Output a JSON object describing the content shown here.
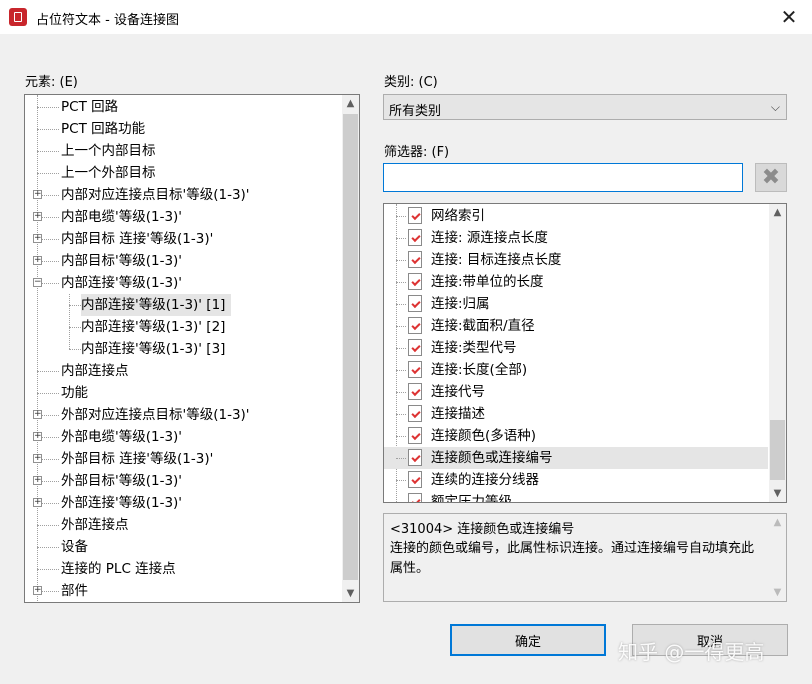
{
  "window": {
    "title": "占位符文本 - 设备连接图",
    "close_glyph": "✕"
  },
  "elements": {
    "label": "元素: (E)",
    "tree": [
      {
        "label": "PCT 回路",
        "level": 0,
        "expander": ""
      },
      {
        "label": "PCT 回路功能",
        "level": 0,
        "expander": ""
      },
      {
        "label": "上一个内部目标",
        "level": 0,
        "expander": ""
      },
      {
        "label": "上一个外部目标",
        "level": 0,
        "expander": ""
      },
      {
        "label": "内部对应连接点目标'等级(1-3)'",
        "level": 0,
        "expander": "+"
      },
      {
        "label": "内部电缆'等级(1-3)'",
        "level": 0,
        "expander": "+"
      },
      {
        "label": "内部目标 连接'等级(1-3)'",
        "level": 0,
        "expander": "+"
      },
      {
        "label": "内部目标'等级(1-3)'",
        "level": 0,
        "expander": "+"
      },
      {
        "label": "内部连接'等级(1-3)'",
        "level": 0,
        "expander": "−"
      },
      {
        "label": "内部连接'等级(1-3)' [1]",
        "level": 1,
        "expander": "",
        "selected": true
      },
      {
        "label": "内部连接'等级(1-3)' [2]",
        "level": 1,
        "expander": ""
      },
      {
        "label": "内部连接'等级(1-3)' [3]",
        "level": 1,
        "expander": ""
      },
      {
        "label": "内部连接点",
        "level": 0,
        "expander": ""
      },
      {
        "label": "功能",
        "level": 0,
        "expander": ""
      },
      {
        "label": "外部对应连接点目标'等级(1-3)'",
        "level": 0,
        "expander": "+"
      },
      {
        "label": "外部电缆'等级(1-3)'",
        "level": 0,
        "expander": "+"
      },
      {
        "label": "外部目标 连接'等级(1-3)'",
        "level": 0,
        "expander": "+"
      },
      {
        "label": "外部目标'等级(1-3)'",
        "level": 0,
        "expander": "+"
      },
      {
        "label": "外部连接'等级(1-3)'",
        "level": 0,
        "expander": "+"
      },
      {
        "label": "外部连接点",
        "level": 0,
        "expander": ""
      },
      {
        "label": "设备",
        "level": 0,
        "expander": ""
      },
      {
        "label": "连接的 PLC 连接点",
        "level": 0,
        "expander": ""
      },
      {
        "label": "部件",
        "level": 0,
        "expander": "+"
      }
    ]
  },
  "category": {
    "label": "类别: (C)",
    "value": "所有类别",
    "chevron": "⌵"
  },
  "filter": {
    "label": "筛选器: (F)",
    "value": "",
    "placeholder": "",
    "clear_glyph": "✖"
  },
  "properties": [
    {
      "label": "网络索引"
    },
    {
      "label": "连接: 源连接点长度"
    },
    {
      "label": "连接: 目标连接点长度"
    },
    {
      "label": "连接:带单位的长度"
    },
    {
      "label": "连接:归属"
    },
    {
      "label": "连接:截面积/直径"
    },
    {
      "label": "连接:类型代号"
    },
    {
      "label": "连接:长度(全部)"
    },
    {
      "label": "连接代号"
    },
    {
      "label": "连接描述"
    },
    {
      "label": "连接颜色(多语种)"
    },
    {
      "label": "连接颜色或连接编号",
      "selected": true
    },
    {
      "label": "连续的连接分线器"
    },
    {
      "label": "额定压力等级"
    }
  ],
  "description": {
    "header": "<31004> 连接颜色或连接编号",
    "text": "连接的颜色或编号，此属性标识连接。通过连接编号自动填充此属性。"
  },
  "buttons": {
    "ok": "确定",
    "cancel": "取消"
  },
  "scroll_arrows": {
    "up": "▲",
    "down": "▼"
  },
  "watermark": "知乎 @一得更高"
}
